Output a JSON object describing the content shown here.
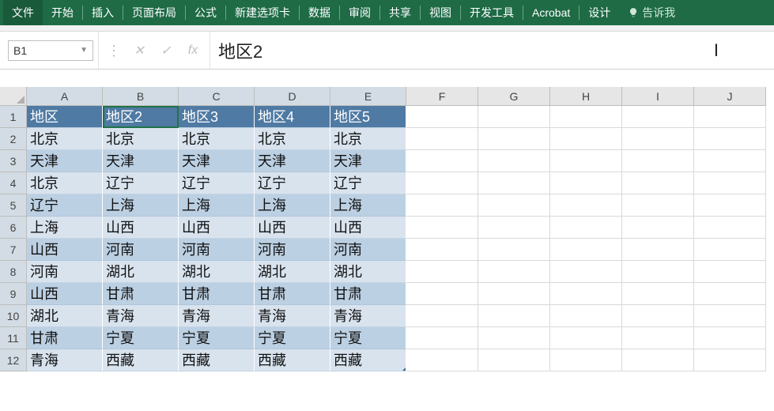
{
  "ribbon": {
    "tabs": [
      "文件",
      "开始",
      "插入",
      "页面布局",
      "公式",
      "新建选项卡",
      "数据",
      "审阅",
      "共享",
      "视图",
      "开发工具",
      "Acrobat",
      "设计"
    ],
    "tell_me": "告诉我"
  },
  "formula_bar": {
    "name_box": "B1",
    "cancel": "✕",
    "confirm": "✓",
    "fx": "fx",
    "content": "地区2"
  },
  "grid": {
    "columns": [
      "A",
      "B",
      "C",
      "D",
      "E",
      "F",
      "G",
      "H",
      "I",
      "J"
    ],
    "row_numbers": [
      1,
      2,
      3,
      4,
      5,
      6,
      7,
      8,
      9,
      10,
      11,
      12
    ],
    "selected_cell": "B1",
    "headers": [
      "地区",
      "地区2",
      "地区3",
      "地区4",
      "地区5"
    ],
    "rows": [
      [
        "北京",
        "北京",
        "北京",
        "北京",
        "北京"
      ],
      [
        "天津",
        "天津",
        "天津",
        "天津",
        "天津"
      ],
      [
        "北京",
        "辽宁",
        "辽宁",
        "辽宁",
        "辽宁"
      ],
      [
        "辽宁",
        "上海",
        "上海",
        "上海",
        "上海"
      ],
      [
        "上海",
        "山西",
        "山西",
        "山西",
        "山西"
      ],
      [
        "山西",
        "河南",
        "河南",
        "河南",
        "河南"
      ],
      [
        "河南",
        "湖北",
        "湖北",
        "湖北",
        "湖北"
      ],
      [
        "山西",
        "甘肃",
        "甘肃",
        "甘肃",
        "甘肃"
      ],
      [
        "湖北",
        "青海",
        "青海",
        "青海",
        "青海"
      ],
      [
        "甘肃",
        "宁夏",
        "宁夏",
        "宁夏",
        "宁夏"
      ],
      [
        "青海",
        "西藏",
        "西藏",
        "西藏",
        "西藏"
      ]
    ]
  }
}
